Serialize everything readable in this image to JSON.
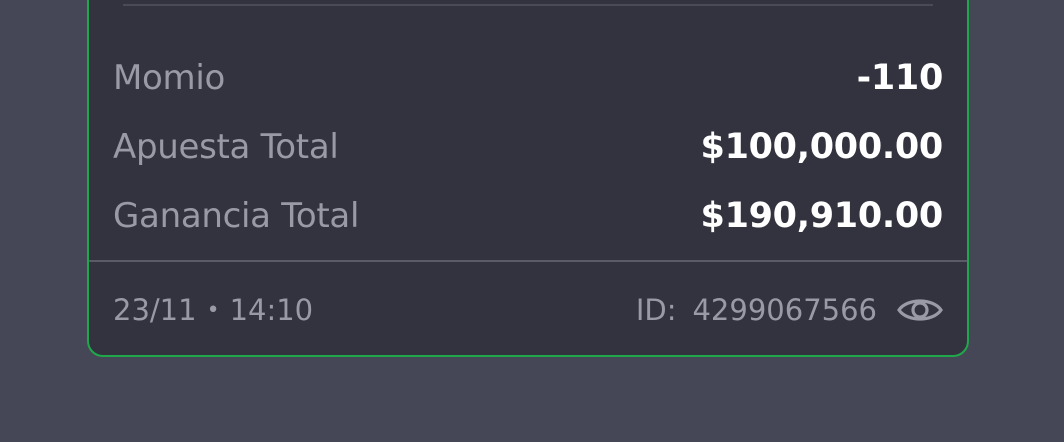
{
  "card": {
    "border_color": "#1fa84a",
    "rows": [
      {
        "label": "Momio",
        "value": "-110"
      },
      {
        "label": "Apuesta Total",
        "value": "$100,000.00"
      },
      {
        "label": "Ganancia Total",
        "value": "$190,910.00"
      }
    ],
    "footer": {
      "date": "23/11",
      "bullet": "•",
      "time": "14:10",
      "id_label": "ID:",
      "id_value": "4299067566",
      "icon": "eye-icon"
    }
  }
}
